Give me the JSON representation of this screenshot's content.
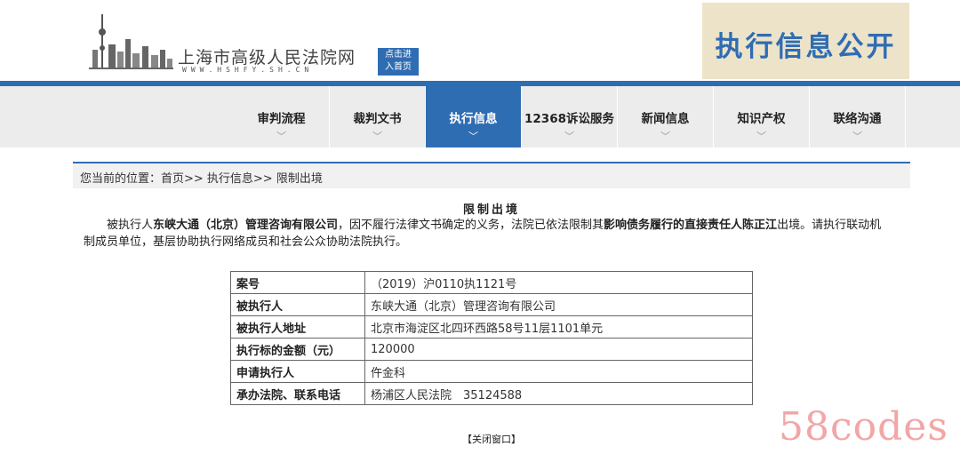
{
  "header": {
    "court_name": "上海市高级人民法院网",
    "court_url": "WWW.HSHFY.SH.CN",
    "home_badge_line1": "点击进",
    "home_badge_line2": "入首页",
    "banner_title": "执行信息公开"
  },
  "nav": {
    "items": [
      {
        "label": "审判流程"
      },
      {
        "label": "裁判文书"
      },
      {
        "label": "执行信息"
      },
      {
        "label": "12368诉讼服务"
      },
      {
        "label": "新闻信息"
      },
      {
        "label": "知识产权"
      },
      {
        "label": "联络沟通"
      }
    ],
    "chevron": "﹀"
  },
  "breadcrumb": "您当前的位置：首页>> 执行信息>> 限制出境",
  "notice": {
    "title": "限制出境",
    "p1": "被执行人",
    "entity": "东峡大通（北京）管理咨询有限公司",
    "p2": "，因不履行法律文书确定的义务，法院已依法限制其",
    "responsible": "影响债务履行的直接责任人陈正江",
    "p3": "出境。请执行联动机制成员单位，基层协助执行网络成员和社会公众协助法院执行。"
  },
  "table": {
    "rows": [
      {
        "key": "案号",
        "value": "（2019）沪0110执1121号"
      },
      {
        "key": "被执行人",
        "value": "东峡大通（北京）管理咨询有限公司"
      },
      {
        "key": "被执行人地址",
        "value": "北京市海淀区北四环西路58号11层1101单元"
      },
      {
        "key": "执行标的金额（元）",
        "value": "120000"
      },
      {
        "key": "申请执行人",
        "value": "仵金科"
      },
      {
        "key": "承办法院、联系电话",
        "value": "杨浦区人民法院　35124588"
      }
    ]
  },
  "close_label": "【关闭窗口】",
  "watermark": "58codes",
  "colors": {
    "accent": "#2f6db3",
    "banner_bg": "#ede3c9",
    "watermark": "#f2a6a6"
  }
}
